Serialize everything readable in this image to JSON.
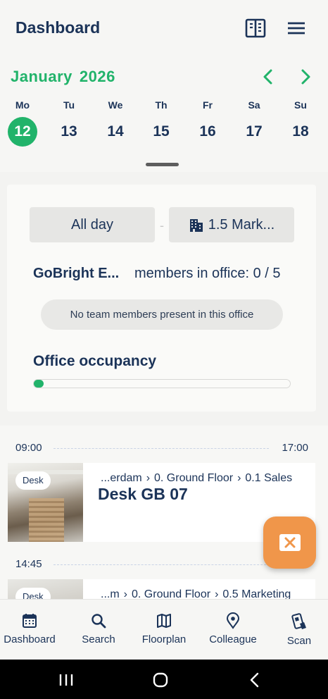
{
  "header": {
    "title": "Dashboard",
    "book_icon": "book-icon",
    "menu_icon": "menu-icon"
  },
  "calendar": {
    "month": "January",
    "year": "2026",
    "weekdays": [
      "Mo",
      "Tu",
      "We",
      "Th",
      "Fr",
      "Sa",
      "Su"
    ],
    "days": [
      "12",
      "13",
      "14",
      "15",
      "16",
      "17",
      "18"
    ],
    "selected_index": 0,
    "accent": "#21b36a"
  },
  "filters": {
    "time": "All day",
    "separator": "-",
    "location": "1.5 Mark..."
  },
  "team": {
    "name": "GoBright E...",
    "members_label": "members in office: 0 / 5",
    "notice": "No team members present in this office"
  },
  "occupancy": {
    "title": "Office occupancy",
    "fraction": 0.03
  },
  "timeline": {
    "slots": [
      {
        "start": "09:00",
        "end": "17:00"
      },
      {
        "start": "14:45",
        "end": ""
      }
    ],
    "bookings": [
      {
        "tag": "Desk",
        "crumbs": [
          "...erdam",
          "0. Ground Floor",
          "0.1 Sales"
        ],
        "title": "Desk GB 07"
      },
      {
        "tag": "Desk",
        "crumbs": [
          "...m",
          "0. Ground Floor",
          "0.5 Marketing"
        ],
        "title": ""
      }
    ]
  },
  "fab": {
    "icon": "close-icon",
    "color": "#f0964a"
  },
  "tabs": [
    {
      "label": "Dashboard",
      "icon": "calendar-icon"
    },
    {
      "label": "Search",
      "icon": "search-icon"
    },
    {
      "label": "Floorplan",
      "icon": "map-icon"
    },
    {
      "label": "Colleague",
      "icon": "location-pin-icon"
    },
    {
      "label": "Scan",
      "icon": "scan-phone-icon"
    }
  ]
}
